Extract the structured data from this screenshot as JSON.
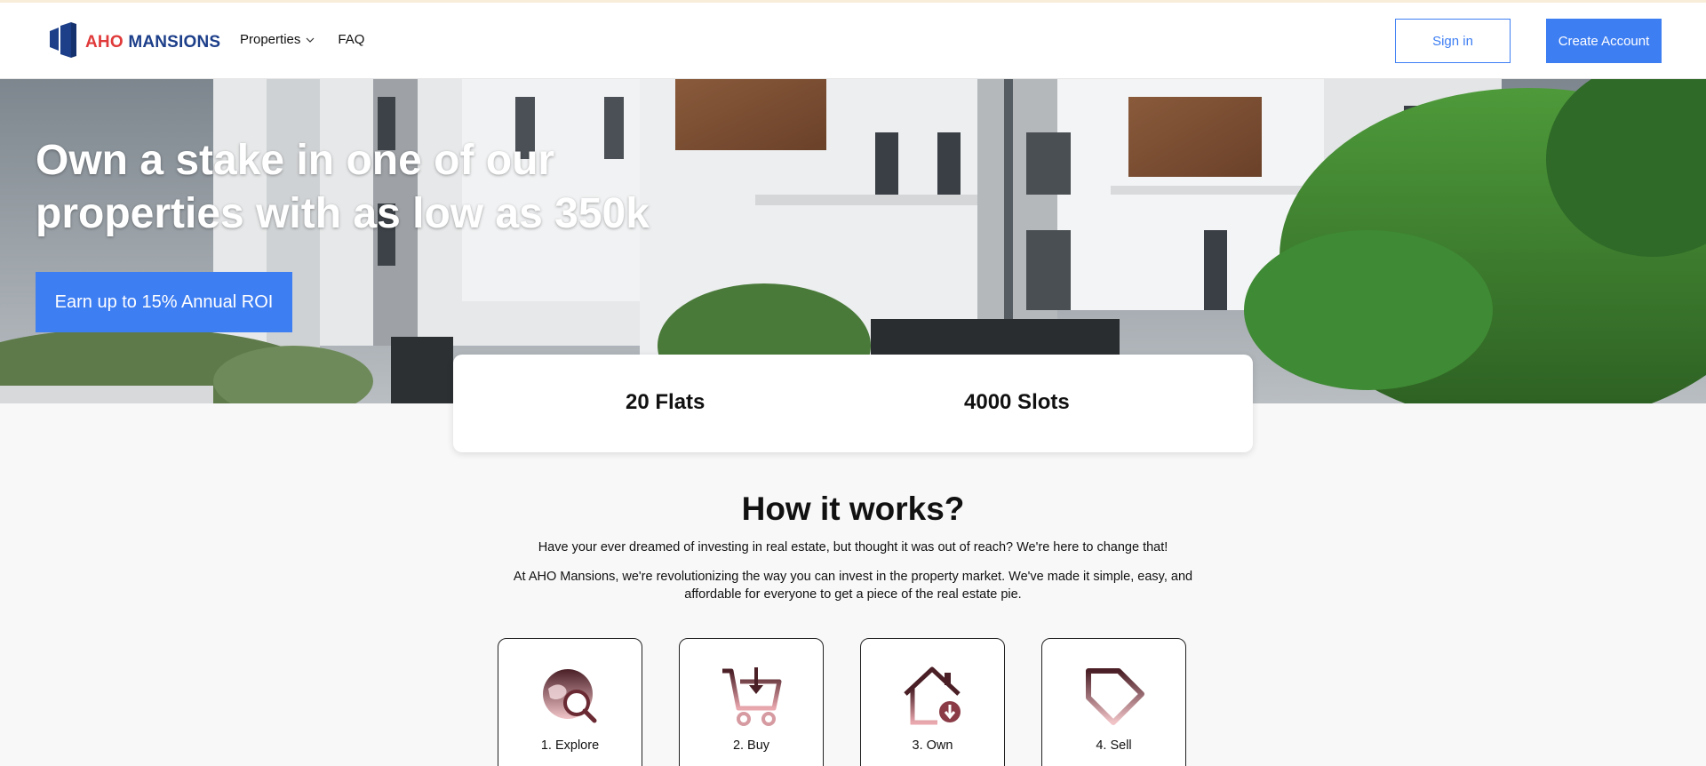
{
  "header": {
    "logo": {
      "part1": "AHO",
      "part2": "MANSIONS"
    },
    "nav": [
      {
        "label": "Properties"
      },
      {
        "label": "FAQ"
      }
    ],
    "sign_in_label": "Sign in",
    "create_account_label": "Create Account"
  },
  "hero": {
    "title": "Own a stake in one of our properties with as low as 350k",
    "cta_label": "Earn up to 15% Annual ROI"
  },
  "stats": [
    {
      "label": "20 Flats"
    },
    {
      "label": "4000 Slots"
    }
  ],
  "how_it_works": {
    "title": "How it works?",
    "paragraph1": "Have your ever dreamed of investing in real estate, but thought it was out of reach? We're here to change that!",
    "paragraph2": "At AHO Mansions, we're revolutionizing the way you can invest in the property market. We've made it simple, easy, and affordable for everyone to get a piece of the real estate pie.",
    "steps": [
      {
        "label": "1. Explore",
        "icon": "explore-icon"
      },
      {
        "label": "2. Buy",
        "icon": "cart-icon"
      },
      {
        "label": "3. Own",
        "icon": "house-icon"
      },
      {
        "label": "4. Sell",
        "icon": "tag-icon"
      }
    ]
  },
  "colors": {
    "primary": "#3d7ef3",
    "logo_red": "#e03a3a",
    "logo_navy": "#1d3f8a",
    "icon_dark": "#4a1f26",
    "icon_light": "#e9a7ae"
  }
}
